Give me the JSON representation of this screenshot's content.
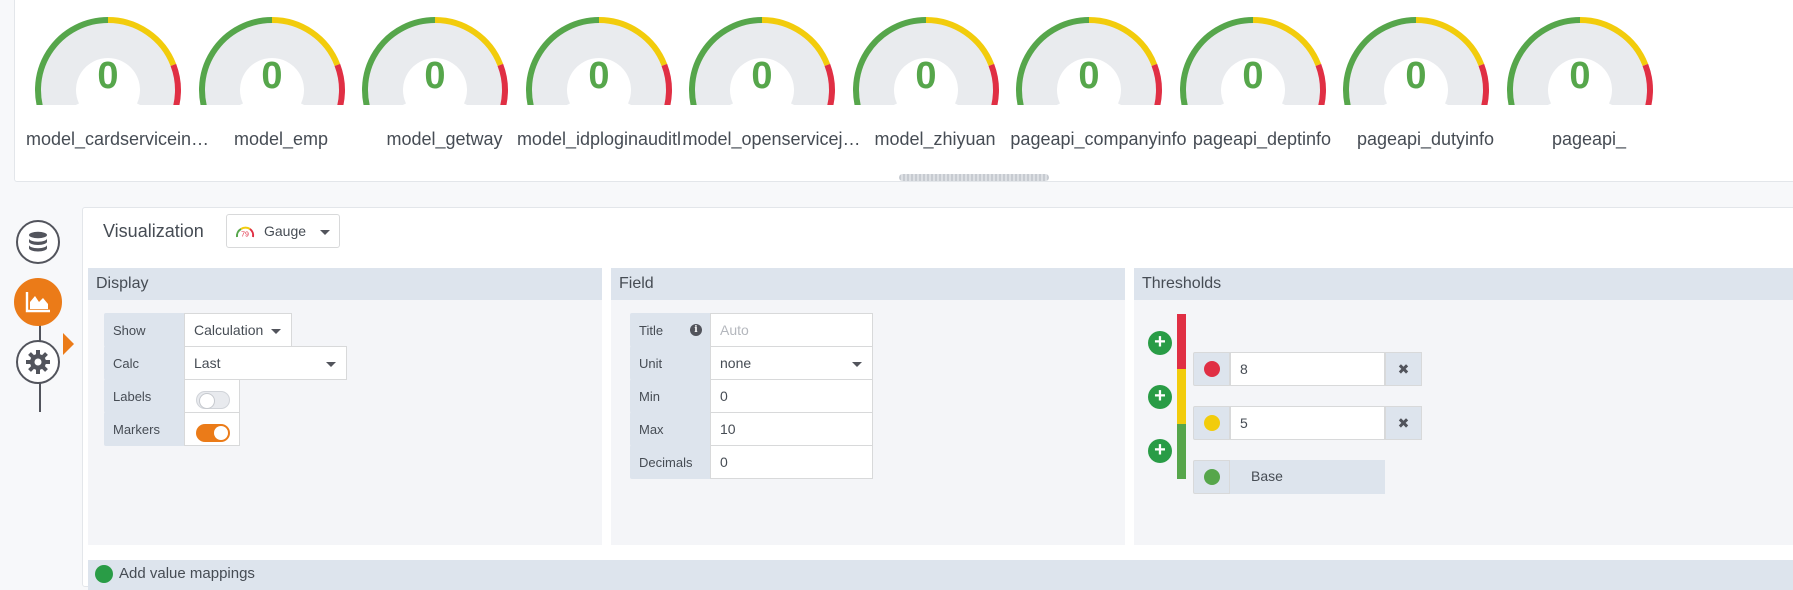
{
  "gauges": [
    {
      "name": "model_cardservicein…",
      "value": "0"
    },
    {
      "name": "model_emp",
      "value": "0"
    },
    {
      "name": "model_getway",
      "value": "0"
    },
    {
      "name": "model_idploginauditl…",
      "value": "0"
    },
    {
      "name": "model_openservicej…",
      "value": "0"
    },
    {
      "name": "model_zhiyuan",
      "value": "0"
    },
    {
      "name": "pageapi_companyinfo",
      "value": "0"
    },
    {
      "name": "pageapi_deptinfo",
      "value": "0"
    },
    {
      "name": "pageapi_dutyinfo",
      "value": "0"
    },
    {
      "name": "pageapi_",
      "value": "0"
    }
  ],
  "colors": {
    "green": "#56a64b",
    "yellow": "#f2cc0c",
    "red": "#e02f44",
    "track": "#e9ebee",
    "accent": "#eb7b18"
  },
  "rail": {
    "steps": [
      {
        "icon": "database-icon",
        "active": false
      },
      {
        "icon": "visualization-icon",
        "active": true
      },
      {
        "icon": "gear-icon",
        "active": false
      }
    ]
  },
  "editor": {
    "visualization_label": "Visualization",
    "visualization_value": "Gauge",
    "gauge_mini_value": "79",
    "display": {
      "title": "Display",
      "show_label": "Show",
      "show_value": "Calculation",
      "calc_label": "Calc",
      "calc_value": "Last",
      "labels_label": "Labels",
      "labels_on": false,
      "markers_label": "Markers",
      "markers_on": true
    },
    "field": {
      "title": "Field",
      "title_label": "Title",
      "title_placeholder": "Auto",
      "unit_label": "Unit",
      "unit_value": "none",
      "min_label": "Min",
      "min_value": "0",
      "max_label": "Max",
      "max_value": "10",
      "decimals_label": "Decimals",
      "decimals_value": "0"
    },
    "thresholds": {
      "title": "Thresholds",
      "items": [
        {
          "value": "8",
          "color": "#e02f44"
        },
        {
          "value": "5",
          "color": "#f2cc0c"
        },
        {
          "value": "Base",
          "color": "#56a64b"
        }
      ]
    },
    "bottom_label": "Add value mappings"
  }
}
